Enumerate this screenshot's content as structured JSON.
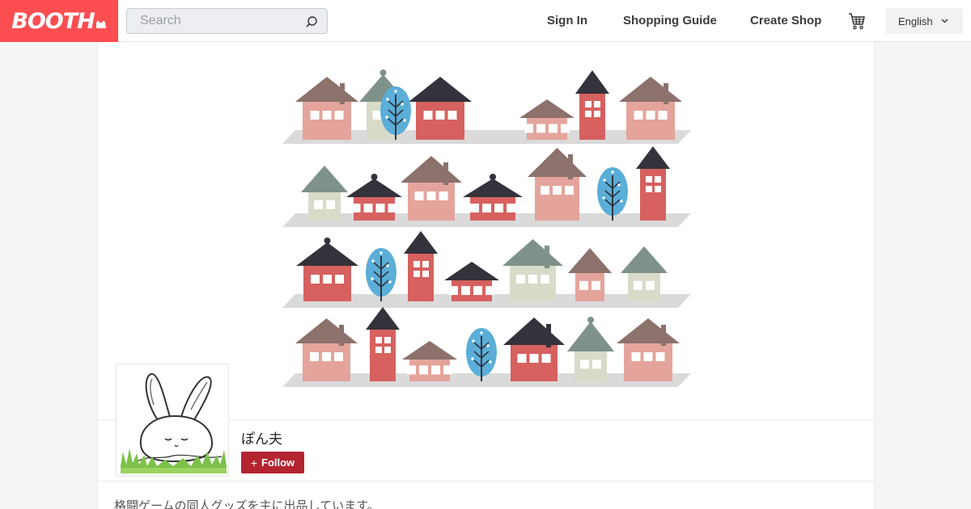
{
  "header": {
    "logo_text": "BOOTH",
    "search_placeholder": "Search",
    "nav": {
      "sign_in": "Sign In",
      "shopping_guide": "Shopping Guide",
      "create_shop": "Create Shop"
    },
    "language": "English"
  },
  "shop": {
    "name": "ぽん夫",
    "follow_label": "Follow",
    "description": "格闘ゲームの同人グッズを主に出品しています。"
  },
  "colors": {
    "brand": "#fc4d50",
    "follow_button": "#b3242f",
    "house_pink": "#e4a49b",
    "house_red": "#d6615f",
    "house_cream": "#d9dbc9",
    "roof_brown": "#8c716c",
    "roof_dark": "#34323a",
    "roof_green": "#7f9289",
    "tree_blue": "#5aaed8",
    "shelf_grey": "#dadada"
  },
  "icons": {
    "search": "search-icon",
    "cart": "cart-icon",
    "language_dropdown": "chevron-down-icon",
    "follow": "plus-icon"
  }
}
